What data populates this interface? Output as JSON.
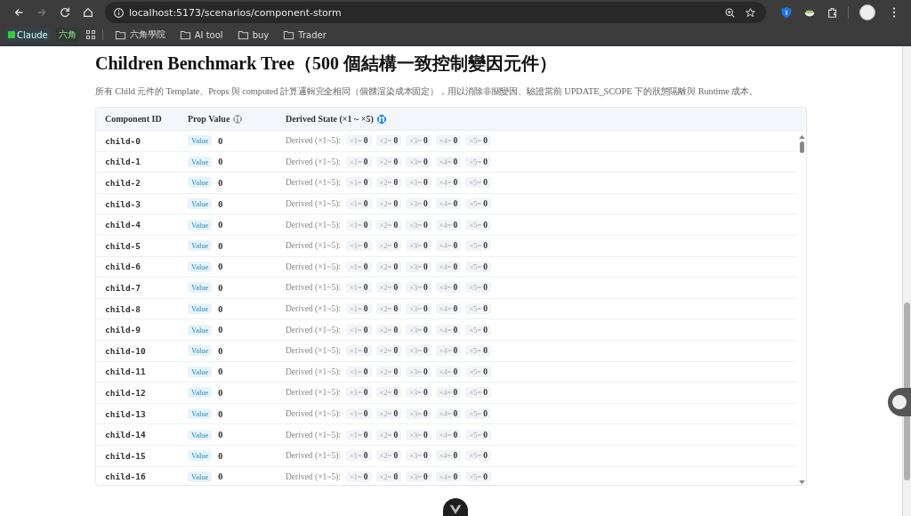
{
  "browser": {
    "url": "localhost:5173/scenarios/component-storm",
    "bookmarks": [
      {
        "kind": "badge",
        "label": "Claude"
      },
      {
        "kind": "tag",
        "label": "六角"
      },
      {
        "kind": "apps"
      },
      {
        "kind": "folder",
        "label": "六角學院"
      },
      {
        "kind": "folder",
        "label": "AI tool"
      },
      {
        "kind": "folder",
        "label": "buy"
      },
      {
        "kind": "folder",
        "label": "Trader"
      }
    ]
  },
  "page": {
    "title": "Children Benchmark Tree（500 個結構一致控制變因元件）",
    "description": "所有 Child 元件的 Template、Props 與 computed 計算邏輯完全相同（個體渲染成本固定），用以消除非關變因、驗證當前 UPDATE_SCOPE 下的狀態隔離與 Runtime 成本。"
  },
  "table": {
    "columns": [
      {
        "label": "Component ID"
      },
      {
        "label": "Prop Value",
        "info_icon": {
          "color": "#aaaaaa"
        }
      },
      {
        "label": "Derived State (×1 ~ ×5)",
        "info_icon": {
          "color": "#1890ff"
        }
      }
    ],
    "rows": [
      {
        "id": "child-0",
        "tag": "Value",
        "value": "0",
        "derived_label": "Derived (×1~5):",
        "chips": [
          {
            "label": "×1=",
            "value": "0"
          },
          {
            "label": "×2=",
            "value": "0"
          },
          {
            "label": "×3=",
            "value": "0"
          },
          {
            "label": "×4=",
            "value": "0"
          },
          {
            "label": "×5=",
            "value": "0"
          }
        ]
      },
      {
        "id": "child-1",
        "tag": "Value",
        "value": "0",
        "derived_label": "Derived (×1~5):",
        "chips": [
          {
            "label": "×1=",
            "value": "0"
          },
          {
            "label": "×2=",
            "value": "0"
          },
          {
            "label": "×3=",
            "value": "0"
          },
          {
            "label": "×4=",
            "value": "0"
          },
          {
            "label": "×5=",
            "value": "0"
          }
        ]
      },
      {
        "id": "child-2",
        "tag": "Value",
        "value": "0",
        "derived_label": "Derived (×1~5):",
        "chips": [
          {
            "label": "×1=",
            "value": "0"
          },
          {
            "label": "×2=",
            "value": "0"
          },
          {
            "label": "×3=",
            "value": "0"
          },
          {
            "label": "×4=",
            "value": "0"
          },
          {
            "label": "×5=",
            "value": "0"
          }
        ]
      },
      {
        "id": "child-3",
        "tag": "Value",
        "value": "0",
        "derived_label": "Derived (×1~5):",
        "chips": [
          {
            "label": "×1=",
            "value": "0"
          },
          {
            "label": "×2=",
            "value": "0"
          },
          {
            "label": "×3=",
            "value": "0"
          },
          {
            "label": "×4=",
            "value": "0"
          },
          {
            "label": "×5=",
            "value": "0"
          }
        ]
      },
      {
        "id": "child-4",
        "tag": "Value",
        "value": "0",
        "derived_label": "Derived (×1~5):",
        "chips": [
          {
            "label": "×1=",
            "value": "0"
          },
          {
            "label": "×2=",
            "value": "0"
          },
          {
            "label": "×3=",
            "value": "0"
          },
          {
            "label": "×4=",
            "value": "0"
          },
          {
            "label": "×5=",
            "value": "0"
          }
        ]
      },
      {
        "id": "child-5",
        "tag": "Value",
        "value": "0",
        "derived_label": "Derived (×1~5):",
        "chips": [
          {
            "label": "×1=",
            "value": "0"
          },
          {
            "label": "×2=",
            "value": "0"
          },
          {
            "label": "×3=",
            "value": "0"
          },
          {
            "label": "×4=",
            "value": "0"
          },
          {
            "label": "×5=",
            "value": "0"
          }
        ]
      },
      {
        "id": "child-6",
        "tag": "Value",
        "value": "0",
        "derived_label": "Derived (×1~5):",
        "chips": [
          {
            "label": "×1=",
            "value": "0"
          },
          {
            "label": "×2=",
            "value": "0"
          },
          {
            "label": "×3=",
            "value": "0"
          },
          {
            "label": "×4=",
            "value": "0"
          },
          {
            "label": "×5=",
            "value": "0"
          }
        ]
      },
      {
        "id": "child-7",
        "tag": "Value",
        "value": "0",
        "derived_label": "Derived (×1~5):",
        "chips": [
          {
            "label": "×1=",
            "value": "0"
          },
          {
            "label": "×2=",
            "value": "0"
          },
          {
            "label": "×3=",
            "value": "0"
          },
          {
            "label": "×4=",
            "value": "0"
          },
          {
            "label": "×5=",
            "value": "0"
          }
        ]
      },
      {
        "id": "child-8",
        "tag": "Value",
        "value": "0",
        "derived_label": "Derived (×1~5):",
        "chips": [
          {
            "label": "×1=",
            "value": "0"
          },
          {
            "label": "×2=",
            "value": "0"
          },
          {
            "label": "×3=",
            "value": "0"
          },
          {
            "label": "×4=",
            "value": "0"
          },
          {
            "label": "×5=",
            "value": "0"
          }
        ]
      },
      {
        "id": "child-9",
        "tag": "Value",
        "value": "0",
        "derived_label": "Derived (×1~5):",
        "chips": [
          {
            "label": "×1=",
            "value": "0"
          },
          {
            "label": "×2=",
            "value": "0"
          },
          {
            "label": "×3=",
            "value": "0"
          },
          {
            "label": "×4=",
            "value": "0"
          },
          {
            "label": "×5=",
            "value": "0"
          }
        ]
      },
      {
        "id": "child-10",
        "tag": "Value",
        "value": "0",
        "derived_label": "Derived (×1~5):",
        "chips": [
          {
            "label": "×1=",
            "value": "0"
          },
          {
            "label": "×2=",
            "value": "0"
          },
          {
            "label": "×3=",
            "value": "0"
          },
          {
            "label": "×4=",
            "value": "0"
          },
          {
            "label": "×5=",
            "value": "0"
          }
        ]
      },
      {
        "id": "child-11",
        "tag": "Value",
        "value": "0",
        "derived_label": "Derived (×1~5):",
        "chips": [
          {
            "label": "×1=",
            "value": "0"
          },
          {
            "label": "×2=",
            "value": "0"
          },
          {
            "label": "×3=",
            "value": "0"
          },
          {
            "label": "×4=",
            "value": "0"
          },
          {
            "label": "×5=",
            "value": "0"
          }
        ]
      },
      {
        "id": "child-12",
        "tag": "Value",
        "value": "0",
        "derived_label": "Derived (×1~5):",
        "chips": [
          {
            "label": "×1=",
            "value": "0"
          },
          {
            "label": "×2=",
            "value": "0"
          },
          {
            "label": "×3=",
            "value": "0"
          },
          {
            "label": "×4=",
            "value": "0"
          },
          {
            "label": "×5=",
            "value": "0"
          }
        ]
      },
      {
        "id": "child-13",
        "tag": "Value",
        "value": "0",
        "derived_label": "Derived (×1~5):",
        "chips": [
          {
            "label": "×1=",
            "value": "0"
          },
          {
            "label": "×2=",
            "value": "0"
          },
          {
            "label": "×3=",
            "value": "0"
          },
          {
            "label": "×4=",
            "value": "0"
          },
          {
            "label": "×5=",
            "value": "0"
          }
        ]
      },
      {
        "id": "child-14",
        "tag": "Value",
        "value": "0",
        "derived_label": "Derived (×1~5):",
        "chips": [
          {
            "label": "×1=",
            "value": "0"
          },
          {
            "label": "×2=",
            "value": "0"
          },
          {
            "label": "×3=",
            "value": "0"
          },
          {
            "label": "×4=",
            "value": "0"
          },
          {
            "label": "×5=",
            "value": "0"
          }
        ]
      },
      {
        "id": "child-15",
        "tag": "Value",
        "value": "0",
        "derived_label": "Derived (×1~5):",
        "chips": [
          {
            "label": "×1=",
            "value": "0"
          },
          {
            "label": "×2=",
            "value": "0"
          },
          {
            "label": "×3=",
            "value": "0"
          },
          {
            "label": "×4=",
            "value": "0"
          },
          {
            "label": "×5=",
            "value": "0"
          }
        ]
      },
      {
        "id": "child-16",
        "tag": "Value",
        "value": "0",
        "derived_label": "Derived (×1~5):",
        "chips": [
          {
            "label": "×1=",
            "value": "0"
          },
          {
            "label": "×2=",
            "value": "0"
          },
          {
            "label": "×3=",
            "value": "0"
          },
          {
            "label": "×4=",
            "value": "0"
          },
          {
            "label": "×5=",
            "value": "0"
          }
        ]
      }
    ]
  }
}
